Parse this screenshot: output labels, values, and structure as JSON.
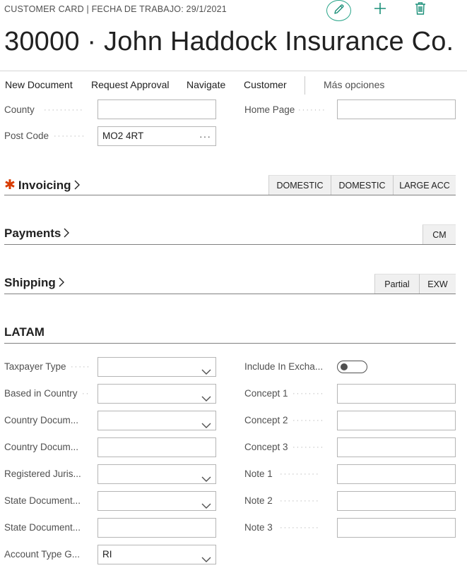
{
  "header": {
    "caption": "CUSTOMER CARD | FECHA DE TRABAJO: 29/1/2021",
    "title": "30000 · John Haddock Insurance Co.",
    "icons": [
      "edit-icon",
      "plus-icon",
      "trash-icon"
    ]
  },
  "actions": {
    "new_document": "New Document",
    "request_approval": "Request Approval",
    "navigate": "Navigate",
    "customer": "Customer",
    "more_options": "Más opciones"
  },
  "address": {
    "county": {
      "label": "County",
      "value": ""
    },
    "post_code": {
      "label": "Post Code",
      "value": "MO2 4RT"
    },
    "home_page": {
      "label": "Home Page",
      "value": ""
    }
  },
  "sections": {
    "invoicing": {
      "title": "Invoicing",
      "required": "✱",
      "chips": [
        "DOMESTIC",
        "DOMESTIC",
        "LARGE ACC"
      ]
    },
    "payments": {
      "title": "Payments",
      "chips": [
        "CM"
      ]
    },
    "shipping": {
      "title": "Shipping",
      "chips": [
        "Partial",
        "EXW"
      ]
    },
    "latam": {
      "title": "LATAM"
    }
  },
  "latam_left": [
    {
      "label": "Taxpayer Type",
      "value": "",
      "kind": "select"
    },
    {
      "label": "Based in Country",
      "value": "",
      "kind": "select"
    },
    {
      "label": "Country Docum...",
      "value": "",
      "kind": "select"
    },
    {
      "label": "Country Docum...",
      "value": "",
      "kind": "text"
    },
    {
      "label": "Registered Juris...",
      "value": "",
      "kind": "select"
    },
    {
      "label": "State Document...",
      "value": "",
      "kind": "select"
    },
    {
      "label": "State Document...",
      "value": "",
      "kind": "text"
    },
    {
      "label": "Account Type G...",
      "value": "RI",
      "kind": "select"
    }
  ],
  "latam_right": [
    {
      "label": "Include In Excha...",
      "value": "off",
      "kind": "toggle"
    },
    {
      "label": "Concept 1",
      "value": "",
      "kind": "text"
    },
    {
      "label": "Concept 2",
      "value": "",
      "kind": "text"
    },
    {
      "label": "Concept 3",
      "value": "",
      "kind": "text"
    },
    {
      "label": "Note 1",
      "value": "",
      "kind": "text"
    },
    {
      "label": "Note 2",
      "value": "",
      "kind": "text"
    },
    {
      "label": "Note 3",
      "value": "",
      "kind": "text"
    }
  ],
  "colors": {
    "accent": "#1a8f78",
    "required": "#d83b01",
    "chip_bg": "#f0f0f0"
  }
}
